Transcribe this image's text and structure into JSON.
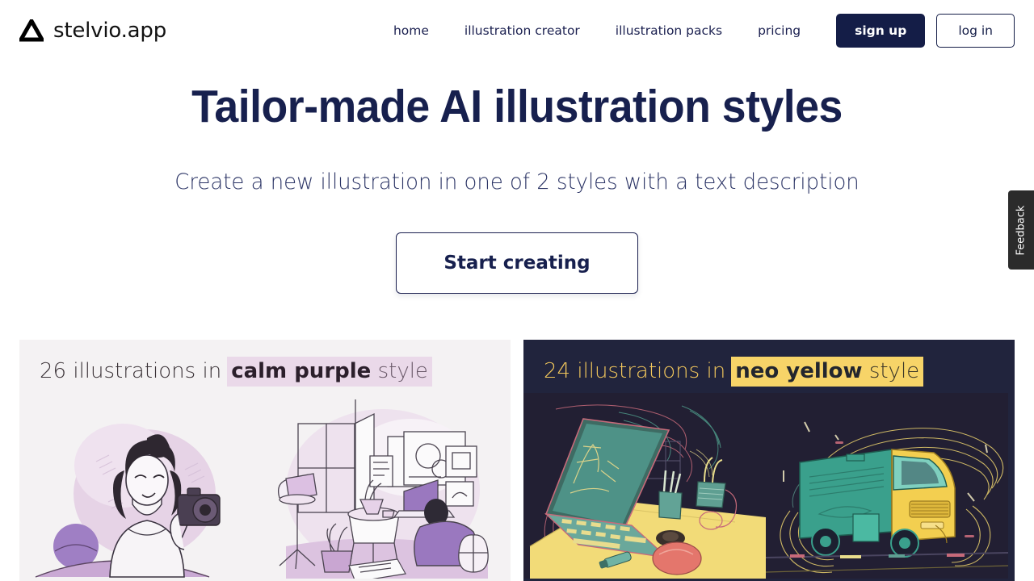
{
  "brand": {
    "name": "stelvio.app",
    "logo_icon": "triangle-logo-icon"
  },
  "nav": {
    "links": [
      {
        "label": "home"
      },
      {
        "label": "illustration creator"
      },
      {
        "label": "illustration packs"
      },
      {
        "label": "pricing"
      }
    ],
    "signup_label": "sign up",
    "login_label": "log in"
  },
  "hero": {
    "title": "Tailor-made AI illustration styles",
    "subtitle": "Create a new illustration in one of 2 styles with a text description",
    "cta_label": "Start creating"
  },
  "cards": [
    {
      "count_text": "26 illustrations in",
      "style_name": "calm purple",
      "style_suffix": "style",
      "theme": "light",
      "bg_color": "#f4f2f3",
      "highlight_color": "#ead9e9",
      "thumbs": [
        {
          "alt": "woman-with-camera-illustration"
        },
        {
          "alt": "workspace-desk-room-illustration"
        }
      ]
    },
    {
      "count_text": "24 illustrations in",
      "style_name": "neo yellow",
      "style_suffix": "style",
      "theme": "dark",
      "bg_color": "#21243d",
      "highlight_color": "#f7d468",
      "thumbs": [
        {
          "alt": "laptop-on-desk-illustration"
        },
        {
          "alt": "delivery-truck-illustration"
        }
      ]
    }
  ],
  "feedback": {
    "label": "Feedback"
  }
}
